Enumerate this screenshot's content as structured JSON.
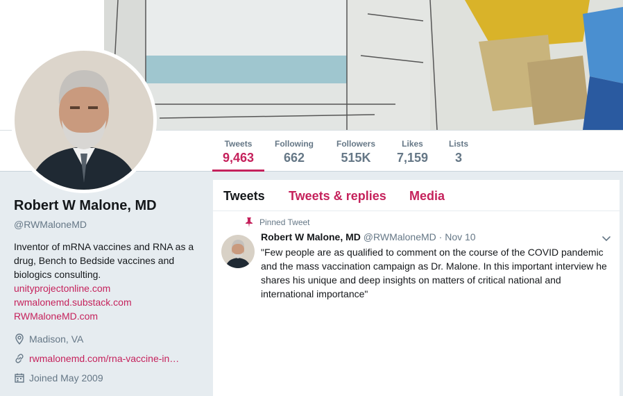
{
  "nav": {
    "stats": [
      {
        "label": "Tweets",
        "value": "9,463"
      },
      {
        "label": "Following",
        "value": "662"
      },
      {
        "label": "Followers",
        "value": "515K"
      },
      {
        "label": "Likes",
        "value": "7,159"
      },
      {
        "label": "Lists",
        "value": "3"
      }
    ]
  },
  "profile": {
    "name": "Robert W Malone, MD",
    "handle": "@RWMaloneMD",
    "bio": "Inventor of mRNA vaccines and RNA as a drug, Bench to Bedside vaccines and biologics consulting.",
    "bio_links": [
      "unityprojectonline.com",
      "rwmalonemd.substack.com",
      "RWMaloneMD.com"
    ],
    "location": "Madison, VA",
    "website": "rwmalonemd.com/rna-vaccine-in…",
    "joined": "Joined May 2009"
  },
  "timeline": {
    "tabs": [
      "Tweets",
      "Tweets & replies",
      "Media"
    ],
    "pinned_label": "Pinned Tweet",
    "tweet": {
      "name": "Robert W Malone, MD",
      "handle": "@RWMaloneMD",
      "separator": "·",
      "date": "Nov 10",
      "text": "\"Few people are as qualified to comment on the course of the COVID pandemic and the mass vaccination campaign as Dr. Malone. In this important interview he shares his unique and deep insights on matters of critical national and international importance\""
    }
  },
  "colors": {
    "accent": "#c5225c",
    "page_bg": "#e6ecf0",
    "muted": "#657786"
  },
  "icons": [
    "map-pin-icon",
    "link-icon",
    "calendar-icon",
    "pin-icon",
    "chevron-down-icon"
  ]
}
